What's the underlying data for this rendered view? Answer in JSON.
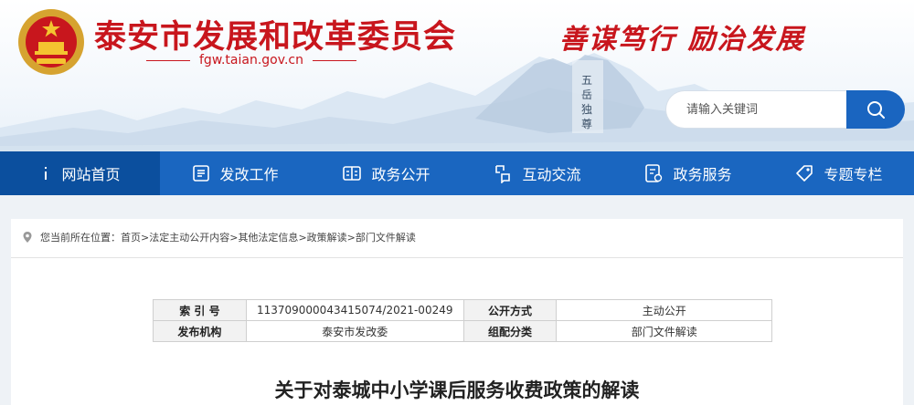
{
  "header": {
    "site_title": "泰安市发展和改革委员会",
    "domain": "fgw.taian.gov.cn",
    "slogan": "善谋笃行  励治发展",
    "colors": {
      "brand_red": "#c8161d",
      "nav_blue": "#1a66c0"
    }
  },
  "search": {
    "placeholder": "请输入关键词",
    "icon": "search-icon"
  },
  "nav": {
    "items": [
      {
        "label": "网站首页",
        "icon": "home-icon"
      },
      {
        "label": "发改工作",
        "icon": "document-icon"
      },
      {
        "label": "政务公开",
        "icon": "book-icon"
      },
      {
        "label": "互动交流",
        "icon": "chat-icon"
      },
      {
        "label": "政务服务",
        "icon": "service-icon"
      },
      {
        "label": "专题专栏",
        "icon": "tag-icon"
      }
    ]
  },
  "breadcrumb": {
    "prefix": "您当前所在位置：",
    "items": [
      "首页",
      "法定主动公开内容",
      "其他法定信息",
      "政策解读",
      "部门文件解读"
    ]
  },
  "info": {
    "index_label": "索 引 号",
    "index_value": "113709000043415074/2021-00249",
    "method_label": "公开方式",
    "method_value": "主动公开",
    "publisher_label": "发布机构",
    "publisher_value": "泰安市发改委",
    "category_label": "组配分类",
    "category_value": "部门文件解读"
  },
  "article": {
    "title": "关于对泰城中小学课后服务收费政策的解读"
  }
}
